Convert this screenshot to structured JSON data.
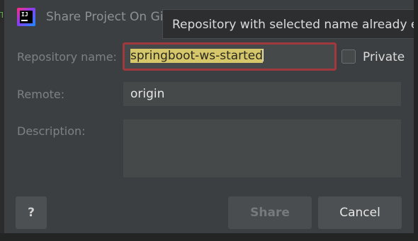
{
  "window": {
    "title": "Share Project On Git",
    "app_icon_text": "IJ"
  },
  "tooltip": {
    "text": "Repository with selected name already exis"
  },
  "form": {
    "repo_name_label": "Repository name:",
    "repo_name_value": "springboot-ws-started",
    "private_label": "Private",
    "private_checked": false,
    "remote_label": "Remote:",
    "remote_value": "origin",
    "description_label": "Description:",
    "description_value": ""
  },
  "buttons": {
    "help_label": "?",
    "share_label": "Share",
    "share_enabled": false,
    "cancel_label": "Cancel"
  },
  "colors": {
    "dialog_bg": "#3c3f41",
    "input_bg": "#45494a",
    "error_outline": "#a0383d",
    "selection_highlight": "#d6c76a"
  }
}
